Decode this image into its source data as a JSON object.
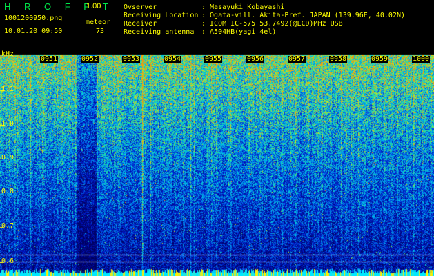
{
  "header": {
    "brand": "H R O F F T",
    "version": "1.00",
    "filename": "1001200950.png",
    "datetime": "10.01.20 09:50",
    "mode_label": "meteor",
    "count": "73"
  },
  "station": {
    "observer_label": "Ovserver",
    "observer_value": ": Masayuki Kobayashi",
    "location_label": "Receiving Location",
    "location_value": ": Ogata-vill. Akita-Pref. JAPAN (139.96E, 40.02N)",
    "receiver_label": "Receiver",
    "receiver_value": ": ICOM IC-575 53.7492(@LCD)MHz USB",
    "antenna_label": "Receiving antenna",
    "antenna_value": ": A504HB(yagi 4el)"
  },
  "spectrogram": {
    "y_unit": "kHz",
    "y_ticks": [
      "1.1",
      "1.0",
      "0.9",
      "0.8",
      "0.7",
      "0.6"
    ],
    "x_ticks": [
      "0951",
      "0952",
      "0953",
      "0954",
      "0955",
      "0956",
      "0957",
      "0958",
      "0959",
      "1000"
    ],
    "colors": {
      "tick_text": "#ffff00",
      "brand": "#00e84a",
      "noise_low": "#000a80",
      "noise_high": "#ffd000"
    }
  }
}
